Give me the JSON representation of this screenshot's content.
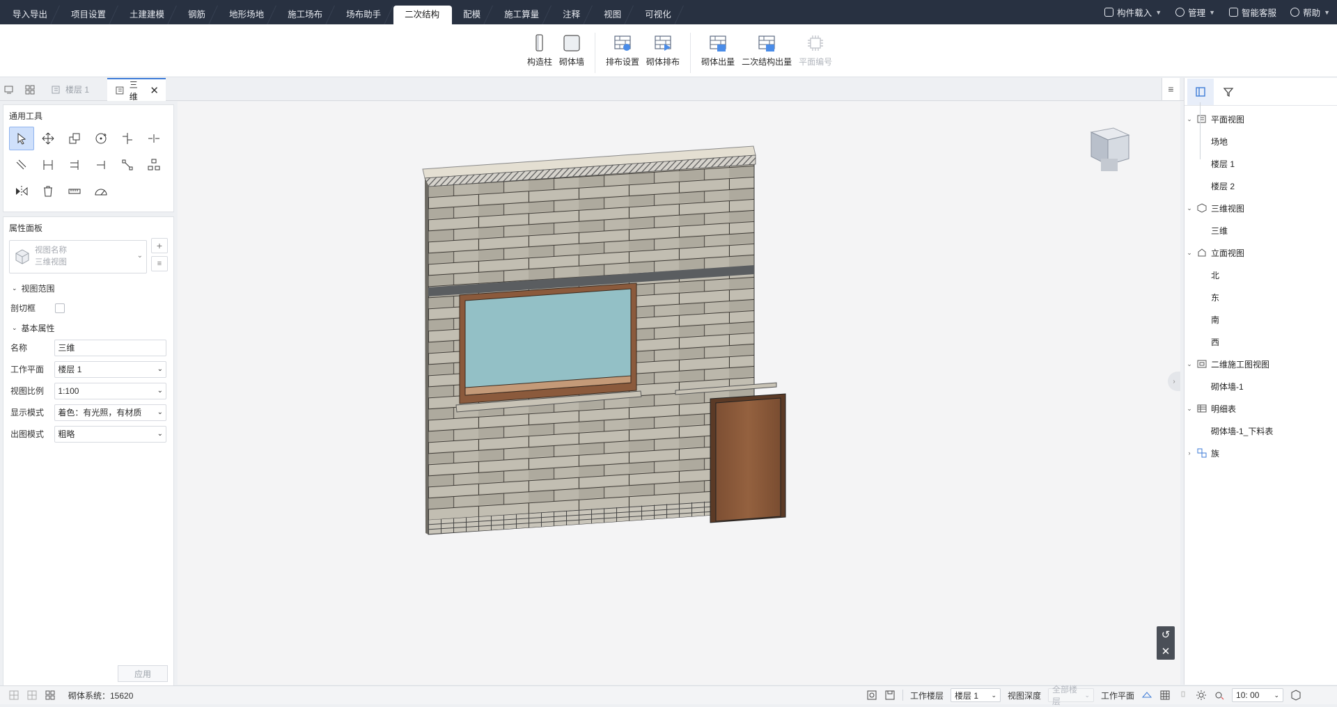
{
  "menu": {
    "tabs": [
      "导入导出",
      "项目设置",
      "土建建模",
      "钢筋",
      "地形场地",
      "施工场布",
      "场布助手",
      "二次结构",
      "配模",
      "施工算量",
      "注释",
      "视图",
      "可视化"
    ],
    "active": "二次结构",
    "right": {
      "component_load": "构件载入",
      "manage": "管理",
      "smart_service": "智能客服",
      "help": "帮助"
    }
  },
  "ribbon": {
    "g1": {
      "col": "构造柱",
      "wall": "砌体墙"
    },
    "g2": {
      "layout_settings": "排布设置",
      "masonry_layout": "砌体排布"
    },
    "g3": {
      "masonry_qty": "砌体出量",
      "secondary_qty": "二次结构出量",
      "plan_number": "平面编号"
    }
  },
  "view_tabs": {
    "floor1": "楼层 1",
    "three_d": "三维"
  },
  "tools": {
    "title": "通用工具"
  },
  "props": {
    "title": "属性面板",
    "view_name_label": "视图名称",
    "view_name_value": "三维视图",
    "section_range": "视图范围",
    "crop_box": "剖切框",
    "section_basic": "基本属性",
    "rows": {
      "name": {
        "label": "名称",
        "value": "三维"
      },
      "work_plane": {
        "label": "工作平面",
        "value": "楼层 1"
      },
      "scale": {
        "label": "视图比例",
        "value": "1:100"
      },
      "display": {
        "label": "显示模式",
        "value": "着色：有光照，有材质"
      },
      "output": {
        "label": "出图模式",
        "value": "粗略"
      }
    },
    "apply": "应用"
  },
  "tree": {
    "plan": "平面视图",
    "site": "场地",
    "floor1": "楼层 1",
    "floor2": "楼层 2",
    "threed": "三维视图",
    "threed_child": "三维",
    "elev": "立面视图",
    "north": "北",
    "east": "东",
    "south": "南",
    "west": "西",
    "drawing": "二维施工图视图",
    "drawing_child": "砌体墙-1",
    "schedule": "明细表",
    "schedule_child": "砌体墙-1_下料表",
    "family": "族"
  },
  "status": {
    "system": "砌体系统：15620",
    "work_floor_label": "工作楼层",
    "work_floor_value": "楼层 1",
    "depth_label": "视图深度",
    "depth_value": "全部楼层",
    "work_plane_label": "工作平面",
    "time": "10: 00"
  },
  "colors": {
    "topbar": "#283141",
    "accent": "#3d7bd7",
    "glass": "#93c0c6",
    "door": "#8a5a3a",
    "brick": "#b7b2a6"
  }
}
